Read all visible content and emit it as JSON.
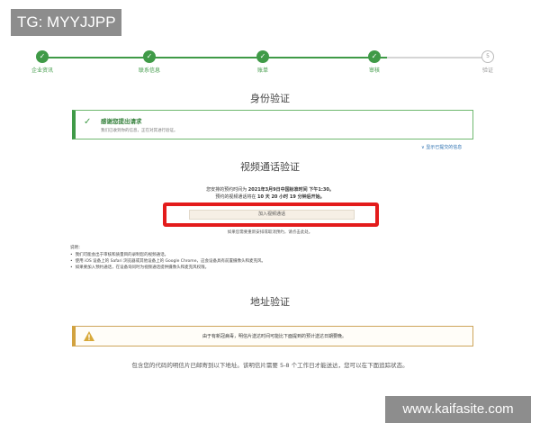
{
  "tag": "TG: MYYJJPP",
  "progress": {
    "steps": [
      {
        "label": "企业资讯",
        "done": true
      },
      {
        "label": "联系信息",
        "done": true
      },
      {
        "label": "账单",
        "done": true
      },
      {
        "label": "审核",
        "done": true
      },
      {
        "label": "验证",
        "done": false,
        "number": "5"
      }
    ]
  },
  "identity": {
    "title": "身份验证",
    "success_title": "感谢您提出请求",
    "success_sub": "我们已收到你的信息，正在对其进行验证。",
    "show_link": "∨ 显示已提交的信息"
  },
  "video": {
    "title": "视频通话验证",
    "appt_line1": "您安排的预约时间为 ",
    "appt_time": "2021年3月9日中国标准时间 下午1:30。",
    "appt_line2": "预约的视频通话将在 ",
    "appt_countdown": "10 天 20 小时 19 分钟后开始。",
    "join_button": "加入视频通话",
    "reschedule": "如果您需要重新安排或取消预约，请点击此处。"
  },
  "notes": {
    "heading": "说明：",
    "items": [
      "我们可能会出于审核和质量目的录制您的视频通话。",
      "使用 iOS 设备上的 Safari 浏览器或其他设备上的 Google Chrome，这会设备具有前置摄像头和麦克风。",
      "如果要加入预约通话，在设备询问时为视频通话提供摄像头和麦克风权限。"
    ]
  },
  "address": {
    "title": "地址验证",
    "warning": "由于有新冠病毒，明信片送达时间可能比下面提到的预计送达日期要晚。",
    "bottom": "包含您的代码的明信片已邮寄到以下地址。该明信片需要 5-8 个工作日才能送达，您可以在下面追踪状态。"
  },
  "watermark": "www.kaifasite.com",
  "colors": {
    "accent_green": "#3f9a47",
    "highlight_red": "#e31b1b",
    "warning_amber": "#d2a23e"
  }
}
